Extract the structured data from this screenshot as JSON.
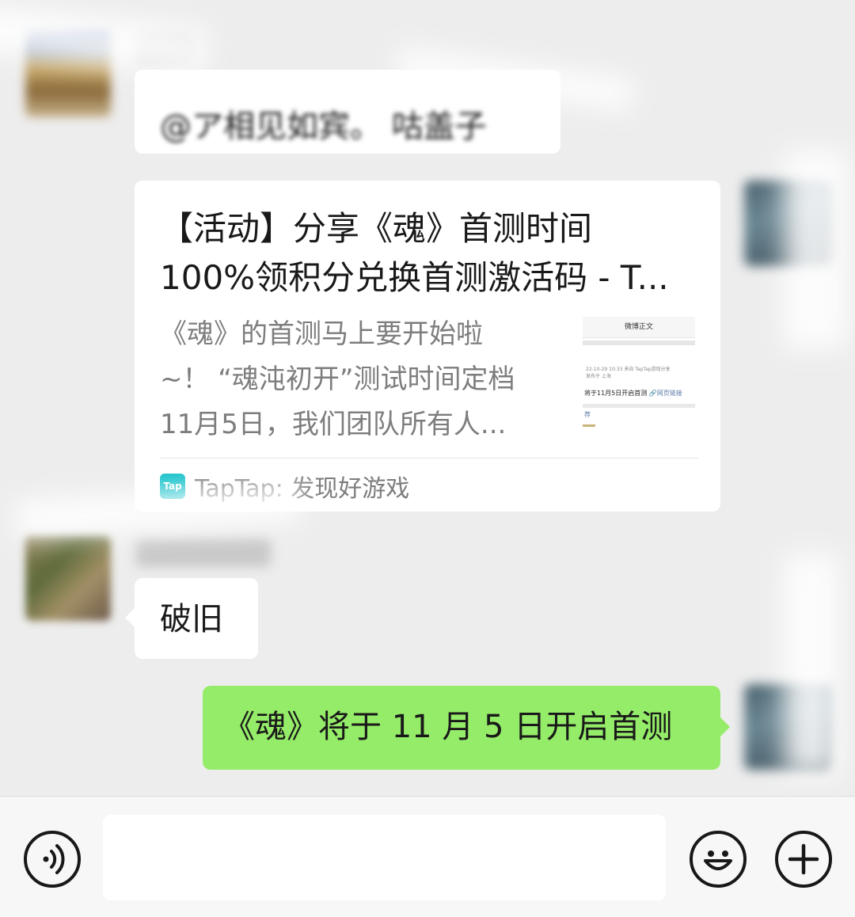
{
  "chat": {
    "messages": [
      {
        "from": "other",
        "text": "@ア相见如宾。 咕盖子"
      },
      {
        "from": "me",
        "type": "link",
        "title_line1": "【活动】分享《魂》首测时间",
        "title_line2": "100%领积分兑换首测激活码 - T...",
        "desc_line1": "《魂》的首测马上要开始啦",
        "desc_line2": "~！ “魂沌初开”测试时间定档",
        "desc_line3": "11月5日，我们团队所有人...",
        "thumb_header": "微博正文",
        "thumb_meta1": "22-10-29 10:33  来自 TapTap游戏分享",
        "thumb_meta2": "发布于 上海",
        "thumb_text": "将于11月5日开启首测",
        "thumb_link": "网页链接",
        "thumb_foot": "荐",
        "source_logo": "Tap",
        "source": "TapTap: 发现好游戏"
      },
      {
        "from": "other",
        "text": "破旧"
      },
      {
        "from": "me",
        "text": "《魂》将于 11 月 5 日开启首测"
      }
    ]
  },
  "input_bar": {
    "voice_icon": "voice-icon",
    "emoji_icon": "emoji-icon",
    "plus_icon": "plus-icon",
    "input_value": ""
  }
}
